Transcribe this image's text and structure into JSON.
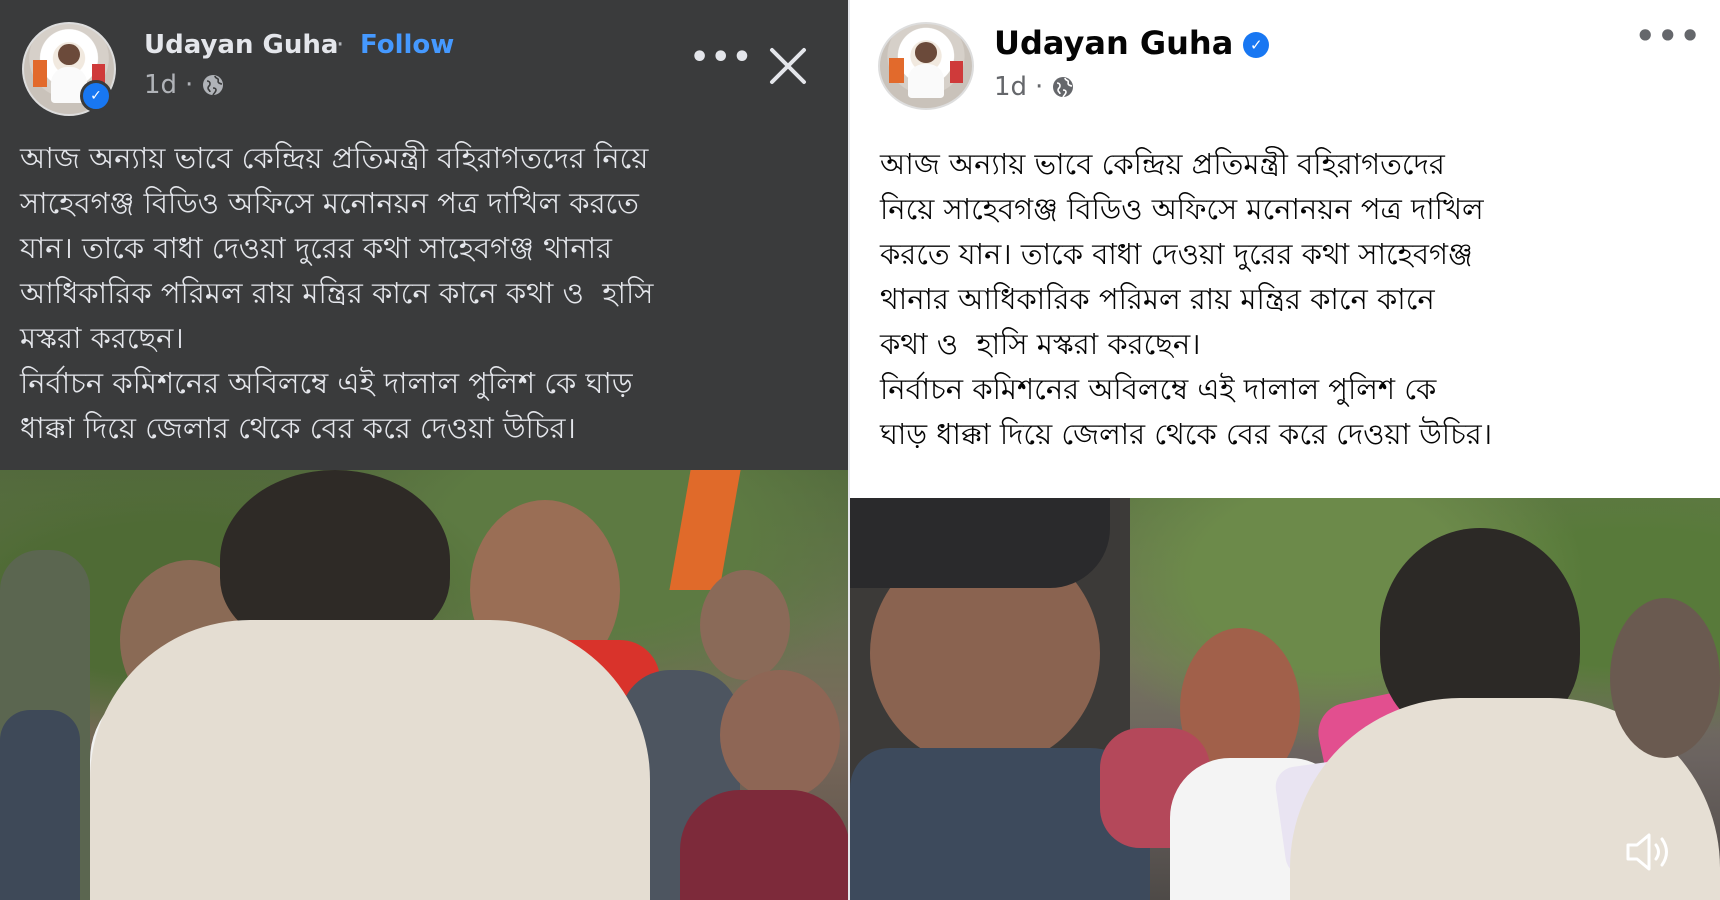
{
  "left_post": {
    "author": "Udayan Guha",
    "separator": "·",
    "follow_label": "Follow",
    "time": "1d",
    "meta_separator": "·",
    "more_icon": "more-options-icon",
    "close_icon": "close-icon",
    "text": "আজ অন্যায় ভাবে কেন্দ্রিয় প্রতিমন্ত্রী বহিরাগতদের নিয়ে\nসাহেবগঞ্জ বিডিও অফিসে মনোনয়ন পত্র দাখিল করতে\nযান। তাকে বাধা দেওয়া দুরের কথা সাহেবগঞ্জ থানার\nআধিকারিক পরিমল রায় মন্ত্রির কানে কানে কথা ও  হাসি\nমস্করা করছেন।\nনির্বাচন কমিশনের অবিলম্বে এই দালাল পুলিশ কে ঘাড়\nধাক্কা দিয়ে জেলার থেকে বের করে দেওয়া উচির।"
  },
  "right_post": {
    "author": "Udayan Guha",
    "time": "1d",
    "meta_separator": "·",
    "more_icon": "more-options-icon",
    "text": "আজ অন্যায় ভাবে কেন্দ্রিয় প্রতিমন্ত্রী বহিরাগতদের\nনিয়ে সাহেবগঞ্জ বিডিও অফিসে মনোনয়ন পত্র দাখিল\nকরতে যান। তাকে বাধা দেওয়া দুরের কথা সাহেবগঞ্জ\nথানার আধিকারিক পরিমল রায় মন্ত্রির কানে কানে\nকথা ও  হাসি মস্করা করছেন।\nনির্বাচন কমিশনের অবিলম্বে এই দালাল পুলিশ কে\nঘাড় ধাক্কা দিয়ে জেলার থেকে বের করে দেওয়া উচির।",
    "sound_icon": "speaker-icon"
  },
  "colors": {
    "dark_bg": "#3a3b3c",
    "dark_text": "#e4e6eb",
    "dark_secondary": "#b0b3b8",
    "follow_blue": "#4599ff",
    "verified_blue": "#1877f2",
    "light_bg": "#ffffff",
    "light_text": "#050505",
    "light_secondary": "#65676b"
  }
}
